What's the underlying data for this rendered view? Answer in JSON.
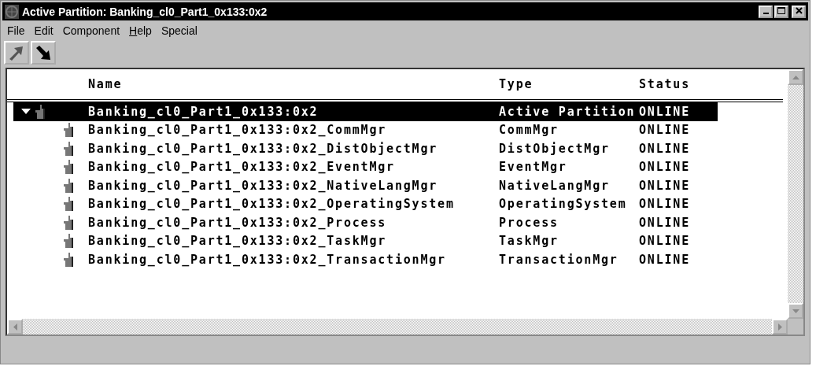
{
  "window": {
    "title": "Active Partition: Banking_cl0_Part1_0x133:0x2"
  },
  "menu": [
    {
      "label": "File",
      "mnemonic": false
    },
    {
      "label": "Edit",
      "mnemonic": false
    },
    {
      "label": "Component",
      "mnemonic": false
    },
    {
      "label": "Help",
      "mnemonic": true
    },
    {
      "label": "Special",
      "mnemonic": false
    }
  ],
  "toolbar": [
    {
      "kind": "up"
    },
    {
      "kind": "down"
    }
  ],
  "table": {
    "columns": [
      "Name",
      "Type",
      "Status"
    ],
    "rows": [
      {
        "name": "Banking_cl0_Part1_0x133:0x2",
        "type": "Active Partition",
        "status": "ONLINE",
        "selected": true,
        "expanded": true,
        "children": [
          {
            "name": "Banking_cl0_Part1_0x133:0x2_CommMgr",
            "type": "CommMgr",
            "status": "ONLINE",
            "selected": false
          },
          {
            "name": "Banking_cl0_Part1_0x133:0x2_DistObjectMgr",
            "type": "DistObjectMgr",
            "status": "ONLINE",
            "selected": false
          },
          {
            "name": "Banking_cl0_Part1_0x133:0x2_EventMgr",
            "type": "EventMgr",
            "status": "ONLINE",
            "selected": false
          },
          {
            "name": "Banking_cl0_Part1_0x133:0x2_NativeLangMgr",
            "type": "NativeLangMgr",
            "status": "ONLINE",
            "selected": false
          },
          {
            "name": "Banking_cl0_Part1_0x133:0x2_OperatingSystem",
            "type": "OperatingSystem",
            "status": "ONLINE",
            "selected": false
          },
          {
            "name": "Banking_cl0_Part1_0x133:0x2_Process",
            "type": "Process",
            "status": "ONLINE",
            "selected": false
          },
          {
            "name": "Banking_cl0_Part1_0x133:0x2_TaskMgr",
            "type": "TaskMgr",
            "status": "ONLINE",
            "selected": false
          },
          {
            "name": "Banking_cl0_Part1_0x133:0x2_TransactionMgr",
            "type": "TransactionMgr",
            "status": "ONLINE",
            "selected": false
          }
        ]
      }
    ]
  }
}
